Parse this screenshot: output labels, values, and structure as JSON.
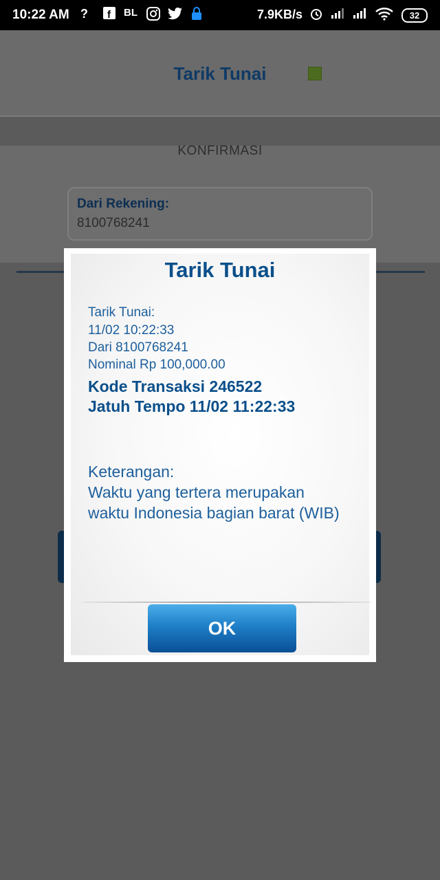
{
  "status_bar": {
    "time": "10:22 AM",
    "icons": [
      "question-wifi-icon",
      "facebook-icon",
      "bukalapak-icon",
      "instagram-icon",
      "twitter-icon",
      "lock-icon"
    ],
    "net_speed": "7.9KB/s",
    "battery": "32"
  },
  "app": {
    "title": "Tarik Tunai",
    "subtitle": "KONFIRMASI",
    "from_account_label": "Dari Rekening:",
    "from_account_value": "8100768241",
    "status_dot_color": "#4d6b1f"
  },
  "dialog": {
    "title": "Tarik Tunai",
    "lines": [
      "Tarik Tunai:",
      "11/02 10:22:33",
      "Dari 8100768241",
      "Nominal Rp 100,000.00"
    ],
    "transaction_code": "Kode Transaksi 246522",
    "due": "Jatuh Tempo 11/02 11:22:33",
    "note_label": "Keterangan:",
    "note_line1": "Waktu yang tertera merupakan",
    "note_line2": "waktu Indonesia bagian barat (WIB)",
    "ok_label": "OK",
    "accent_color": "#0b4f8a"
  }
}
